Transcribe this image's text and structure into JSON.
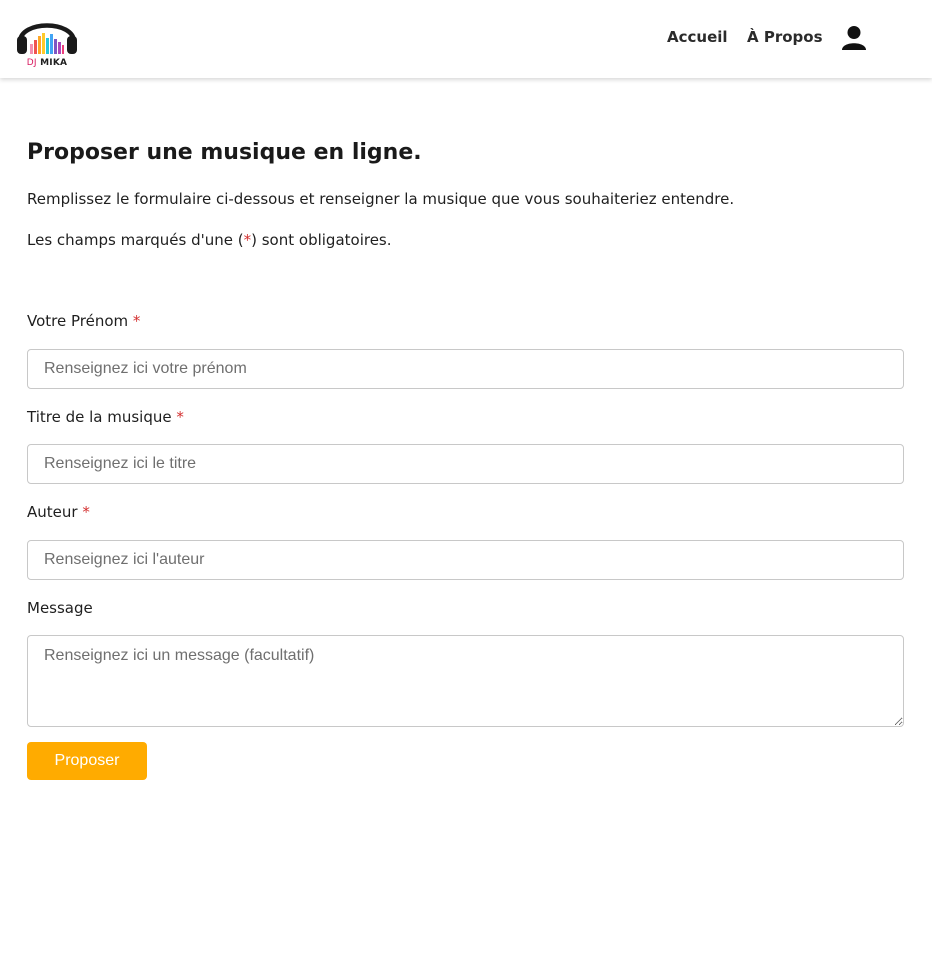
{
  "brand": {
    "logo_dj": "DJ",
    "logo_name": "MIKA"
  },
  "nav": {
    "home": "Accueil",
    "about": "À Propos",
    "user_icon": "user-icon"
  },
  "page": {
    "title": "Proposer une musique en ligne.",
    "intro": "Remplissez le formulaire ci-dessous et renseigner la musique que vous souhaiteriez entendre.",
    "required_prefix": "Les champs marqués d'une (",
    "required_star": "*",
    "required_suffix": ") sont obligatoires."
  },
  "form": {
    "firstname": {
      "label": "Votre Prénom",
      "required": "*",
      "placeholder": "Renseignez ici votre prénom",
      "value": ""
    },
    "title": {
      "label": "Titre de la musique",
      "required": "*",
      "placeholder": "Renseignez ici le titre",
      "value": ""
    },
    "author": {
      "label": "Auteur",
      "required": "*",
      "placeholder": "Renseignez ici l'auteur",
      "value": ""
    },
    "message": {
      "label": "Message",
      "placeholder": "Renseignez ici un message (facultatif)",
      "value": ""
    },
    "submit_label": "Proposer"
  },
  "colors": {
    "accent": "#ffab00",
    "required": "#d32f2f",
    "brand_pink": "#d81b60"
  }
}
